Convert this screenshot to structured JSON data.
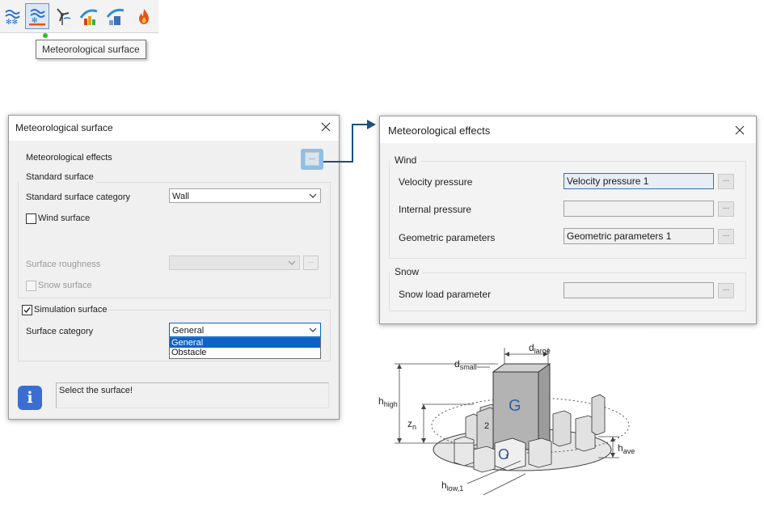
{
  "toolbar": {
    "tooltip": "Meteorological surface",
    "icons": [
      "snow-wind-icon",
      "meteorological-surface-icon",
      "wind-turbine-icon",
      "wind-load-icon",
      "wind-building-icon",
      "fire-icon"
    ]
  },
  "left_dialog": {
    "title": "Meteorological surface",
    "meteorological_effects_label": "Meteorological effects",
    "ellipsis": "...",
    "standard_surface_group": "Standard surface",
    "standard_surface_category_label": "Standard surface category",
    "standard_surface_category_value": "Wall",
    "wind_surface_label": "Wind surface",
    "surface_roughness_label": "Surface roughness",
    "snow_surface_label": "Snow surface",
    "simulation_surface_label": "Simulation surface",
    "surface_category_label": "Surface category",
    "surface_category_value": "General",
    "dropdown_options": [
      "General",
      "Obstacle"
    ],
    "info_icon": "i",
    "status_message": "Select the surface!"
  },
  "right_dialog": {
    "title": "Meteorological effects",
    "wind_group": "Wind",
    "velocity_pressure_label": "Velocity pressure",
    "velocity_pressure_value": "Velocity pressure 1",
    "internal_pressure_label": "Internal pressure",
    "geometric_parameters_label": "Geometric parameters",
    "geometric_parameters_value": "Geometric parameters 1",
    "snow_group": "Snow",
    "snow_load_parameter_label": "Snow load parameter",
    "ellipsis": "..."
  },
  "diagram": {
    "d_small_base": "d",
    "d_small_sub": "small",
    "d_large_base": "d",
    "d_large_sub": "large",
    "h_high_base": "h",
    "h_high_sub": "high",
    "z_n_base": "z",
    "z_n_sub": "n",
    "h_ave_base": "h",
    "h_ave_sub": "ave",
    "h_low_base": "h",
    "h_low_sub": "low,1",
    "label_G": "G",
    "label_O": "O",
    "label_2": "2",
    "label_1": "1"
  },
  "colors": {
    "accent": "#2f5fa6",
    "highlight_button": "#8fbfe6",
    "selection": "#0a64c8",
    "connector": "#1f4e79",
    "info_icon": "#3a6fd0"
  }
}
